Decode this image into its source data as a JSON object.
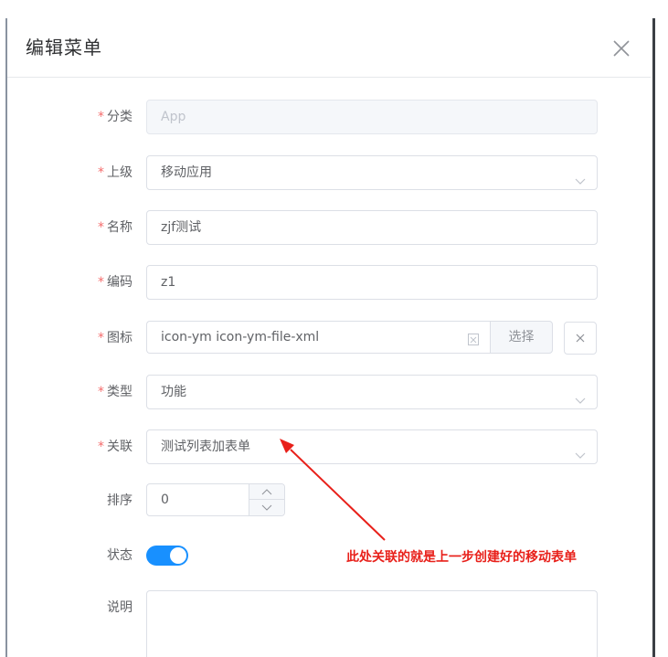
{
  "dialog": {
    "title": "编辑菜单",
    "close_icon": "close-icon"
  },
  "form": {
    "category": {
      "label": "分类",
      "required": "*",
      "value": "App"
    },
    "parent": {
      "label": "上级",
      "required": "*",
      "value": "移动应用"
    },
    "name": {
      "label": "名称",
      "required": "*",
      "value": "zjf测试"
    },
    "code": {
      "label": "编码",
      "required": "*",
      "value": "z1"
    },
    "icon": {
      "label": "图标",
      "required": "*",
      "value": "icon-ym icon-ym-file-xml",
      "button": "选择"
    },
    "type": {
      "label": "类型",
      "required": "*",
      "value": "功能"
    },
    "relation": {
      "label": "关联",
      "required": "*",
      "value": "测试列表加表单"
    },
    "sort": {
      "label": "排序",
      "value": "0"
    },
    "status": {
      "label": "状态",
      "on": true
    },
    "description": {
      "label": "说明",
      "value": ""
    }
  },
  "annotation": {
    "text": "此处关联的就是上一步创建好的移动表单",
    "color": "#e8201a"
  },
  "colors": {
    "primary": "#1890ff",
    "required": "#f56c6c",
    "border": "#dcdfe6"
  }
}
